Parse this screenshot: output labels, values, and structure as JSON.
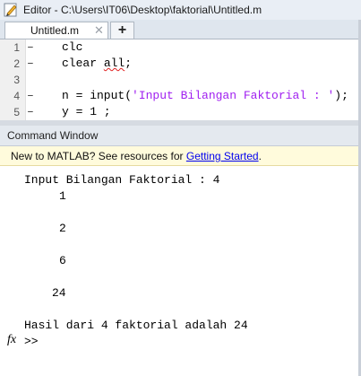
{
  "window": {
    "title": "Editor - C:\\Users\\IT06\\Desktop\\faktorial\\Untitled.m"
  },
  "tabs": [
    {
      "label": "Untitled.m",
      "close": "✕"
    }
  ],
  "addtab": "+",
  "editor": {
    "lines": [
      {
        "num": "1",
        "mark": "–",
        "code_before": "clc",
        "code_after": ""
      },
      {
        "num": "2",
        "mark": "–",
        "code_before": "clear ",
        "squiggle": "all",
        "code_after": ";"
      },
      {
        "num": "3",
        "mark": "",
        "code_before": "",
        "code_after": ""
      },
      {
        "num": "4",
        "mark": "–",
        "code_before": "n = input(",
        "string": "'Input Bilangan Faktorial : '",
        "code_after": ");"
      },
      {
        "num": "5",
        "mark": "–",
        "code_before": "y = 1 ;",
        "code_after": ""
      }
    ]
  },
  "command_window": {
    "title": "Command Window",
    "banner_text": "New to MATLAB? See resources for ",
    "banner_link": "Getting Started",
    "banner_end": ".",
    "output": [
      "Input Bilangan Faktorial : 4",
      "1",
      "2",
      "6",
      "24",
      "Hasil dari 4 faktorial adalah 24"
    ],
    "fx_label": "fx",
    "prompt": ">>"
  }
}
